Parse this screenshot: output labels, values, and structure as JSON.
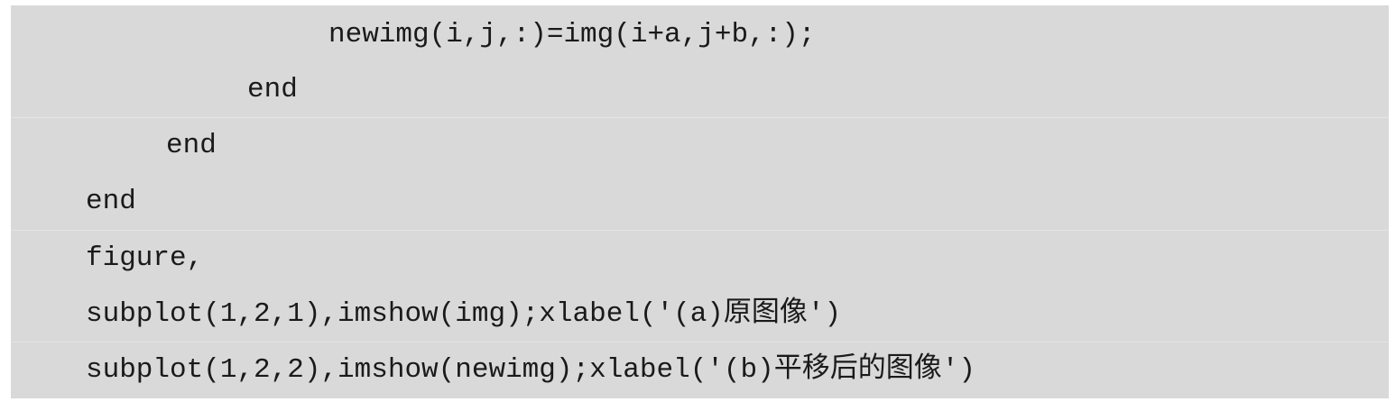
{
  "code": {
    "lines": [
      "newimg(i,j,:)=img(i+a,j+b,:);",
      "end",
      "end",
      "end",
      "figure,",
      "subplot(1,2,1),imshow(img);xlabel('(a)原图像')",
      "subplot(1,2,2),imshow(newimg);xlabel('(b)平移后的图像')"
    ]
  }
}
